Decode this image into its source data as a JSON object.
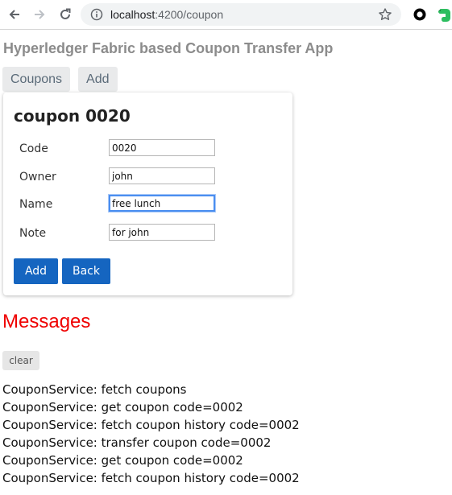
{
  "browser": {
    "url_host": "localhost",
    "url_rest": ":4200/coupon"
  },
  "app": {
    "title": "Hyperledger Fabric based Coupon Transfer App",
    "nav": [
      "Coupons",
      "Add"
    ]
  },
  "coupon_form": {
    "heading": "coupon 0020",
    "fields": [
      {
        "label": "Code",
        "value": "0020"
      },
      {
        "label": "Owner",
        "value": "john"
      },
      {
        "label": "Name",
        "value": "free lunch"
      },
      {
        "label": "Note",
        "value": "for john"
      }
    ],
    "add_label": "Add",
    "back_label": "Back"
  },
  "messages": {
    "heading": "Messages",
    "clear_label": "clear",
    "items": [
      "CouponService: fetch coupons",
      "CouponService: get coupon code=0002",
      "CouponService: fetch coupon history code=0002",
      "CouponService: transfer coupon code=0002",
      "CouponService: get coupon code=0002",
      "CouponService: fetch coupon history code=0002"
    ]
  },
  "colors": {
    "primary_button": "#1565c0",
    "messages_heading": "#ef0000",
    "focus_ring": "#4a8ef0"
  }
}
